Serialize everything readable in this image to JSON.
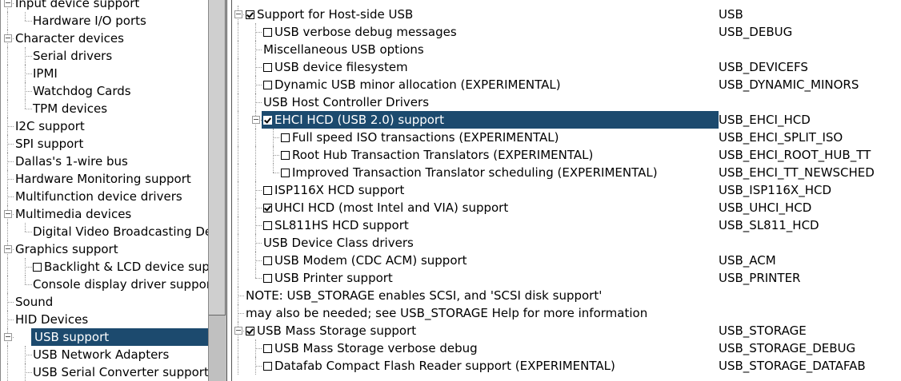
{
  "left_tree": [
    {
      "label": "Input device support",
      "depth": 0,
      "expander": true
    },
    {
      "label": "Hardware I/O ports",
      "depth": 1,
      "last": true
    },
    {
      "label": "Character devices",
      "depth": 0,
      "expander": true
    },
    {
      "label": "Serial drivers",
      "depth": 1
    },
    {
      "label": "IPMI",
      "depth": 1
    },
    {
      "label": "Watchdog Cards",
      "depth": 1
    },
    {
      "label": "TPM devices",
      "depth": 1,
      "last": true
    },
    {
      "label": "I2C support",
      "depth": 0
    },
    {
      "label": "SPI support",
      "depth": 0
    },
    {
      "label": "Dallas's 1-wire bus",
      "depth": 0
    },
    {
      "label": "Hardware Monitoring support",
      "depth": 0
    },
    {
      "label": "Multifunction device drivers",
      "depth": 0
    },
    {
      "label": "Multimedia devices",
      "depth": 0,
      "expander": true
    },
    {
      "label": "Digital Video Broadcasting Devices",
      "depth": 1,
      "last": true
    },
    {
      "label": "Graphics support",
      "depth": 0,
      "expander": true
    },
    {
      "label": "Backlight & LCD device support",
      "depth": 1,
      "checkbox": false
    },
    {
      "label": "Console display driver support",
      "depth": 1,
      "last": true
    },
    {
      "label": "Sound",
      "depth": 0
    },
    {
      "label": "HID Devices",
      "depth": 0
    },
    {
      "label": "USB support",
      "depth": 0,
      "expander": true,
      "selected": true
    },
    {
      "label": "USB Network Adapters",
      "depth": 1
    },
    {
      "label": "USB Serial Converter support",
      "depth": 1
    }
  ],
  "right_tree": [
    {
      "label": "Support for Host-side USB",
      "symbol": "USB",
      "depth": 0,
      "expander": true,
      "checkbox": true
    },
    {
      "label": "USB verbose debug messages",
      "symbol": "USB_DEBUG",
      "depth": 1,
      "checkbox": false
    },
    {
      "label": "Miscellaneous USB options",
      "symbol": "",
      "depth": 1
    },
    {
      "label": "USB device filesystem",
      "symbol": "USB_DEVICEFS",
      "depth": 1,
      "checkbox": false
    },
    {
      "label": "Dynamic USB minor allocation (EXPERIMENTAL)",
      "symbol": "USB_DYNAMIC_MINORS",
      "depth": 1,
      "checkbox": false
    },
    {
      "label": "USB Host Controller Drivers",
      "symbol": "",
      "depth": 1
    },
    {
      "label": "EHCI HCD (USB 2.0) support",
      "symbol": "USB_EHCI_HCD",
      "depth": 1,
      "expander": true,
      "checkbox": true,
      "selected": true
    },
    {
      "label": "Full speed ISO transactions (EXPERIMENTAL)",
      "symbol": "USB_EHCI_SPLIT_ISO",
      "depth": 2,
      "checkbox": false
    },
    {
      "label": "Root Hub Transaction Translators (EXPERIMENTAL)",
      "symbol": "USB_EHCI_ROOT_HUB_TT",
      "depth": 2,
      "checkbox": false
    },
    {
      "label": "Improved Transaction Translator scheduling (EXPERIMENTAL)",
      "symbol": "USB_EHCI_TT_NEWSCHED",
      "depth": 2,
      "checkbox": false,
      "last": true
    },
    {
      "label": "ISP116X HCD support",
      "symbol": "USB_ISP116X_HCD",
      "depth": 1,
      "checkbox": false
    },
    {
      "label": "UHCI HCD (most Intel and VIA) support",
      "symbol": "USB_UHCI_HCD",
      "depth": 1,
      "checkbox": true
    },
    {
      "label": "SL811HS HCD support",
      "symbol": "USB_SL811_HCD",
      "depth": 1,
      "checkbox": false
    },
    {
      "label": "USB Device Class drivers",
      "symbol": "",
      "depth": 1
    },
    {
      "label": "USB Modem (CDC ACM) support",
      "symbol": "USB_ACM",
      "depth": 1,
      "checkbox": false
    },
    {
      "label": "USB Printer support",
      "symbol": "USB_PRINTER",
      "depth": 1,
      "checkbox": false,
      "last": true
    },
    {
      "label": "NOTE: USB_STORAGE enables SCSI, and 'SCSI disk support'",
      "symbol": "",
      "depth": 0
    },
    {
      "label": "may also be needed; see USB_STORAGE Help for more information",
      "symbol": "",
      "depth": 0
    },
    {
      "label": "USB Mass Storage support",
      "symbol": "USB_STORAGE",
      "depth": 0,
      "expander": true,
      "checkbox": true
    },
    {
      "label": "USB Mass Storage verbose debug",
      "symbol": "USB_STORAGE_DEBUG",
      "depth": 1,
      "checkbox": false
    },
    {
      "label": "Datafab Compact Flash Reader support (EXPERIMENTAL)",
      "symbol": "USB_STORAGE_DATAFAB",
      "depth": 1,
      "checkbox": false
    }
  ],
  "colors": {
    "selection": "#1c4a6e",
    "tree_lines": "#999999"
  },
  "icons": {
    "expander": "minus-expander-icon",
    "checkbox": "checkbox-icon"
  }
}
